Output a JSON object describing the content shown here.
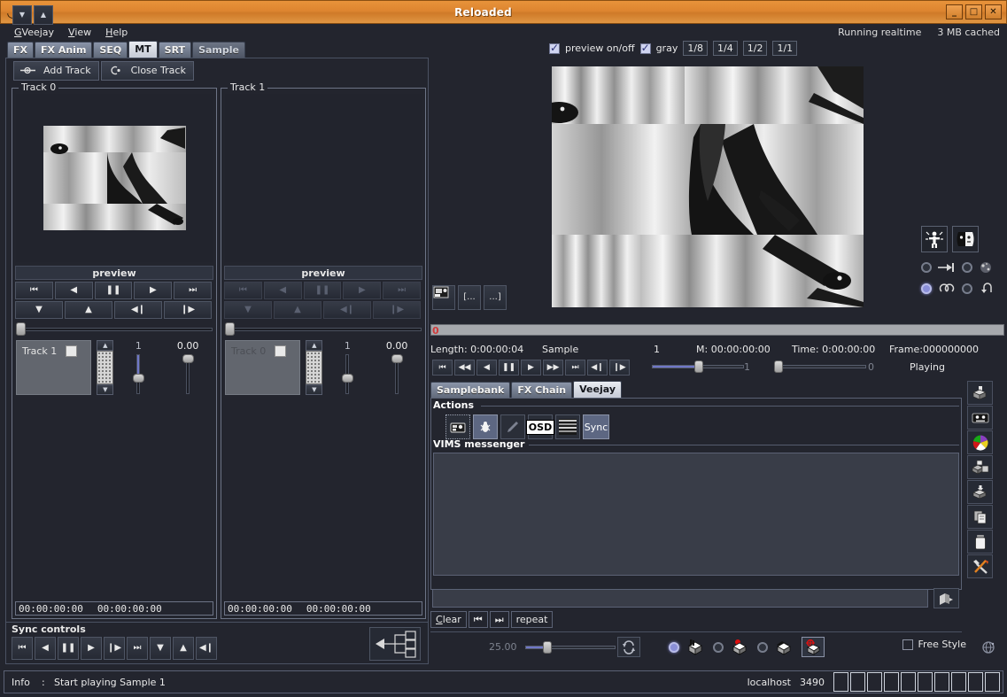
{
  "window": {
    "title": "Reloaded",
    "minimize": "_",
    "maximize": "□",
    "close": "✕",
    "icon": "veejay-logo-icon"
  },
  "menu": {
    "items": [
      "GVeejay",
      "View",
      "Help"
    ]
  },
  "status": {
    "realtime": "Running realtime",
    "cache": "3 MB cached"
  },
  "main_tabs": [
    {
      "label": "FX",
      "state": "normal"
    },
    {
      "label": "FX Anim",
      "state": "normal"
    },
    {
      "label": "SEQ",
      "state": "normal"
    },
    {
      "label": "MT",
      "state": "selected"
    },
    {
      "label": "SRT",
      "state": "normal"
    },
    {
      "label": "Sample",
      "state": "dim"
    }
  ],
  "mt": {
    "add_track": "Add Track",
    "close_track": "Close Track",
    "tracks": [
      {
        "frame_label": "Track 0",
        "preview_label": "preview",
        "has_video": true,
        "mix_label": "Track 1",
        "spin_value": "1",
        "opacity_value": "0.00",
        "time_in": "00:00:00:00",
        "time_out": "00:00:00:00",
        "transport_row1": [
          "⏮",
          "◀",
          "❚❚",
          "▶",
          "⏭"
        ],
        "transport_row2": [
          "▼",
          "▲",
          "◀❙",
          "❙▶"
        ]
      },
      {
        "frame_label": "Track 1",
        "preview_label": "preview",
        "has_video": false,
        "mix_label": "Track 0",
        "spin_value": "1",
        "opacity_value": "0.00",
        "time_in": "00:00:00:00",
        "time_out": "00:00:00:00",
        "transport_row1": [
          "⏮",
          "◀",
          "❚❚",
          "▶",
          "⏭"
        ],
        "transport_row2": [
          "▼",
          "▲",
          "◀❙",
          "❙▶"
        ]
      }
    ]
  },
  "sync": {
    "title": "Sync controls",
    "buttons": [
      "⏮",
      "◀",
      "❚❚",
      "▶",
      "❙▶",
      "⏭",
      "▼",
      "▲",
      "◀❙"
    ]
  },
  "preview_header": {
    "preview_onoff": "preview on/off",
    "gray": "gray",
    "zoom_levels": [
      "1/8",
      "1/4",
      "1/2",
      "1/1"
    ]
  },
  "small_buttons": [
    "screenshot-icon",
    "[...",
    "...]"
  ],
  "sample_info": {
    "length_label": "Length: 0:00:00:04",
    "sample_label": "Sample",
    "sample_number": "1",
    "marker_label": "M: 00:00:00:00",
    "time_label": "Time: 0:00:00:00",
    "frame_label": "Frame:000000000",
    "state": "Playing",
    "speed_max": "1",
    "position_max": "0"
  },
  "transport_main": [
    "⏮",
    "◀◀",
    "◀",
    "❚❚",
    "▶",
    "▶▶",
    "⏭",
    "◀❙",
    "❙▶"
  ],
  "notebook_tabs": [
    {
      "label": "Samplebank",
      "state": "normal"
    },
    {
      "label": "FX Chain",
      "state": "normal"
    },
    {
      "label": "Veejay",
      "state": "selected"
    }
  ],
  "veejay_panel": {
    "actions_label": "Actions",
    "action_buttons": [
      {
        "name": "camera-icon",
        "label": "",
        "state": "dotted"
      },
      {
        "name": "bug-icon",
        "label": "",
        "state": "active"
      },
      {
        "name": "pencil-icon",
        "label": "",
        "state": "disabled"
      },
      {
        "name": "osd-icon",
        "label": "OSD",
        "state": "normal"
      },
      {
        "name": "interlace-icon",
        "label": "",
        "state": "normal"
      },
      {
        "name": "sync-button",
        "label": "Sync",
        "state": "active"
      }
    ],
    "vims_label": "VIMS messenger",
    "message_input_value": "",
    "send_icon": "send-message-icon",
    "clear_label": "Clear",
    "prev_label": "⏮",
    "next_label": "⏭",
    "repeat_label": "repeat"
  },
  "bottom_controls": {
    "fps_value": "25.00",
    "loop_icon": "loop-icon",
    "free_style_label": "Free Style",
    "free_style_icon": "globe-icon",
    "play_modes": [
      {
        "name": "mode-radio-1",
        "selected": true
      },
      {
        "name": "mode-cube-plain-icon",
        "selected": false
      },
      {
        "name": "mode-radio-2",
        "selected": false
      },
      {
        "name": "mode-cube-red-icon",
        "selected": false
      },
      {
        "name": "mode-radio-3",
        "selected": false
      },
      {
        "name": "mode-cube-dark-icon",
        "selected": false
      },
      {
        "name": "mode-cube-target-icon",
        "selected": true
      }
    ]
  },
  "right_toolbar": [
    {
      "name": "load-sample-icon"
    },
    {
      "name": "tape-icon"
    },
    {
      "name": "color-wheel-icon"
    },
    {
      "name": "add-sample-icon"
    },
    {
      "name": "save-sample-icon"
    },
    {
      "name": "copy-icon"
    },
    {
      "name": "trash-icon"
    },
    {
      "name": "tools-icon"
    }
  ],
  "video_right_controls": {
    "big_buttons": [
      {
        "name": "person-fx-icon"
      },
      {
        "name": "mask-icon"
      }
    ],
    "row2": [
      {
        "name": "radio-a",
        "selected": false
      },
      {
        "name": "arrow-to-end-icon"
      },
      {
        "name": "radio-b",
        "selected": false
      },
      {
        "name": "sphere-icon"
      }
    ],
    "row3": [
      {
        "name": "radio-c",
        "selected": true
      },
      {
        "name": "loop-pingpong-icon"
      },
      {
        "name": "radio-d",
        "selected": false
      },
      {
        "name": "loop-back-icon"
      }
    ]
  },
  "info_bar": {
    "label": "Info",
    "separator": ":",
    "message": "Start playing Sample 1"
  },
  "host": {
    "name": "localhost",
    "port": "3490"
  },
  "colors": {
    "title_bar": "#dd8530",
    "accent_blue": "#6f77c8",
    "panel_bg": "#23252e",
    "selected_tab": "#c3c8d4"
  }
}
